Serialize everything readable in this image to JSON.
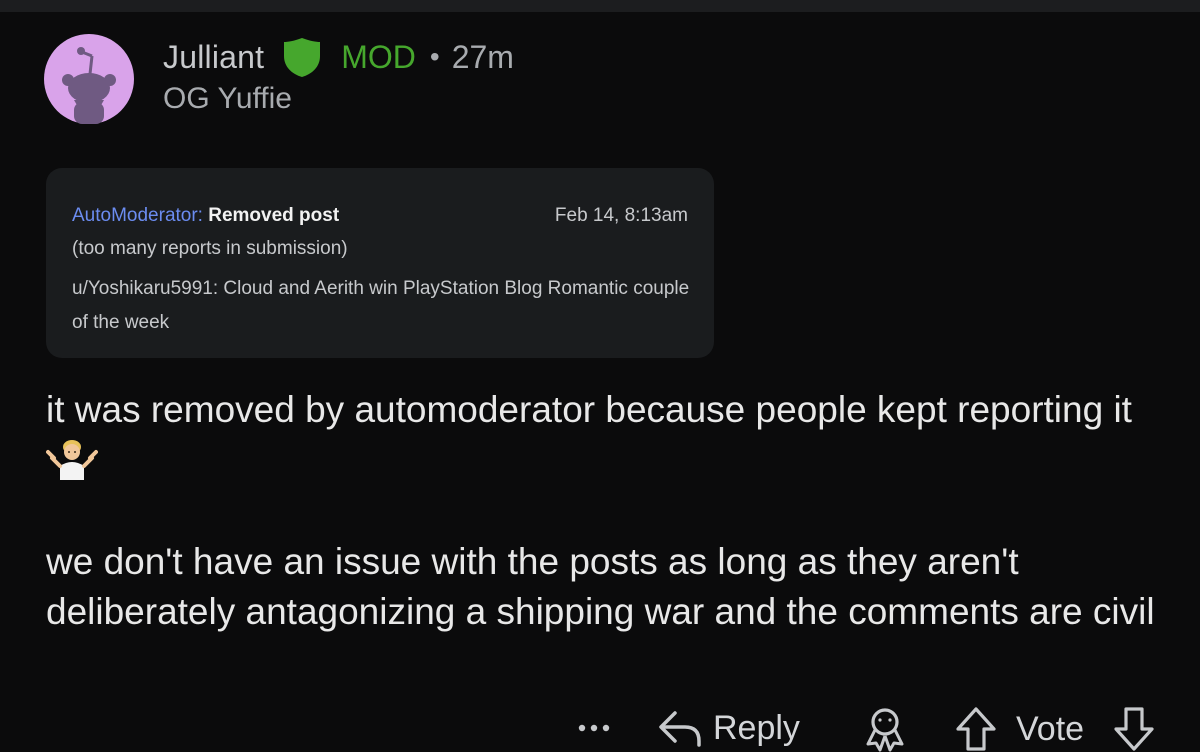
{
  "comment": {
    "author": {
      "username": "Julliant",
      "role_badge": "MOD",
      "separator": "•",
      "timestamp": "27m",
      "flair": "OG Yuffie",
      "avatar_icon": "reddit-snoo-avatar-icon",
      "badge_icon": "mod-shield-icon",
      "colors": {
        "mod_green": "#46a72d",
        "avatar_bg": "#d9a3ea"
      }
    },
    "mod_log": {
      "actor": "AutoModerator:",
      "action": "Removed post",
      "date": "Feb 14, 8:13am",
      "reason": "(too many reports in submission)",
      "post_title": "u/Yoshikaru5991: Cloud and Aerith win PlayStation Blog Romantic couple of the week",
      "colors": {
        "actor_link": "#6b8cf0"
      }
    },
    "body": {
      "paragraph_1": "it was removed by automoderator because people kept reporting it",
      "emoji": "person-shrugging-emoji",
      "paragraph_2": "we don't have an issue with the posts as long as they aren't deliberately antagonizing a shipping war and the comments are civil"
    },
    "actions": {
      "more_icon": "more-dots-icon",
      "reply_label": "Reply",
      "reply_icon": "reply-arrow-icon",
      "award_icon": "award-icon",
      "upvote_icon": "upvote-arrow-icon",
      "vote_label": "Vote",
      "downvote_icon": "downvote-arrow-icon"
    }
  }
}
